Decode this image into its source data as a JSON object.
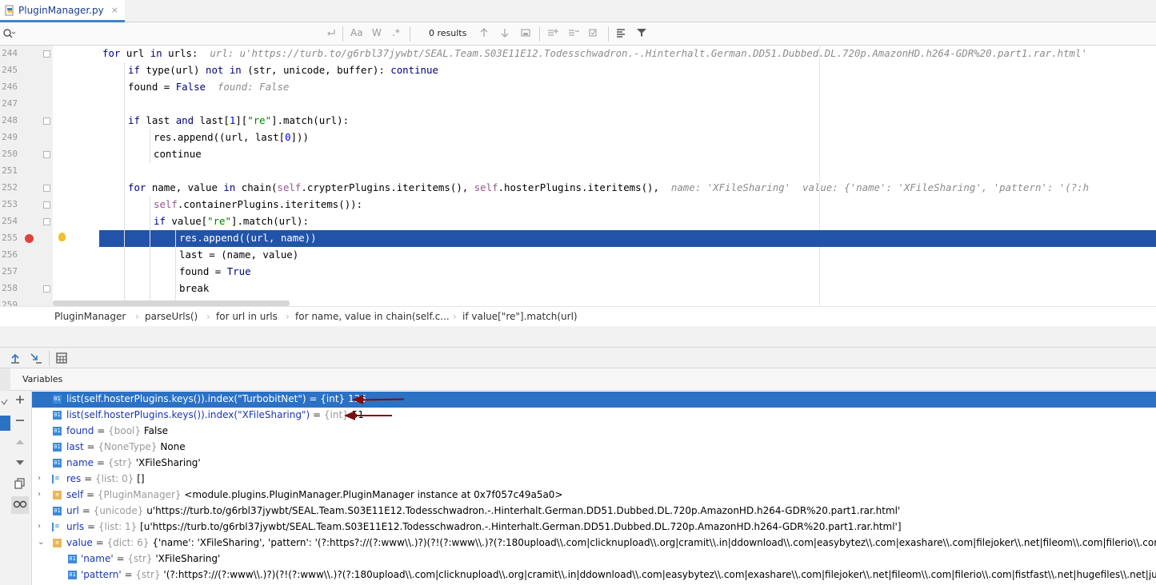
{
  "tab": {
    "filename": "PluginManager.py",
    "close": "×"
  },
  "search": {
    "results": "0 results",
    "match_case": "Aa",
    "words": "W",
    "regex": ".*"
  },
  "editor": {
    "lines": [
      {
        "n": "244"
      },
      {
        "n": "245"
      },
      {
        "n": "246"
      },
      {
        "n": "247"
      },
      {
        "n": "248"
      },
      {
        "n": "249"
      },
      {
        "n": "250"
      },
      {
        "n": "251"
      },
      {
        "n": "252"
      },
      {
        "n": "253"
      },
      {
        "n": "254"
      },
      {
        "n": "255"
      },
      {
        "n": "256"
      },
      {
        "n": "257"
      },
      {
        "n": "258"
      },
      {
        "n": "259"
      }
    ],
    "code": {
      "l244_a": "for",
      "l244_b": " url ",
      "l244_c": "in",
      "l244_d": " urls:  ",
      "l244_hint": "url: u'https://turb.to/g6rbl37jywbt/SEAL.Team.S03E11E12.Todesschwadron.-.Hinterhalt.German.DD51.Dubbed.DL.720p.AmazonHD.h264-GDR%20.part1.rar.html'",
      "l245": "if type(url) not in (str, unicode, buffer): continue",
      "l246_a": "found = ",
      "l246_b": "False",
      "l246_hint": "found: False",
      "l248_a": "if",
      "l248_b": " last ",
      "l248_c": "and",
      "l248_d": " last[",
      "l248_e": "1",
      "l248_f": "][",
      "l248_g": "\"re\"",
      "l248_h": "].match(url):",
      "l249_a": "res.append((url, last[",
      "l249_b": "0",
      "l249_c": "]))",
      "l250": "continue",
      "l252_a": "for",
      "l252_b": " name, value ",
      "l252_c": "in",
      "l252_d": " chain(",
      "l252_e": "self",
      "l252_f": ".crypterPlugins.iteritems(), ",
      "l252_g": "self",
      "l252_h": ".hosterPlugins.iteritems(),  ",
      "l252_hint": "name: 'XFileSharing'  value: {'name': 'XFileSharing', 'pattern': '(?:h",
      "l253_a": "self",
      "l253_b": ".containerPlugins.iteritems()):",
      "l254_a": "if",
      "l254_b": " value[",
      "l254_c": "\"re\"",
      "l254_d": "].match(url):",
      "l255": "res.append((url, name))",
      "l256": "last = (name, value)",
      "l257_a": "found = ",
      "l257_b": "True",
      "l258": "break"
    }
  },
  "breadcrumb": [
    "PluginManager",
    "parseUrls()",
    "for url in urls",
    "for name, value in chain(self.c...",
    "if value[\"re\"].match(url)"
  ],
  "variables_title": "Variables",
  "variables": [
    {
      "icon": "01",
      "name": "list(self.hosterPlugins.keys()).index(\"TurbobitNet\")",
      "type": "{int}",
      "value": "136"
    },
    {
      "icon": "01",
      "name": "list(self.hosterPlugins.keys()).index(\"XFileSharing\")",
      "type": "{int}",
      "value": "51"
    },
    {
      "icon": "01",
      "name": "found",
      "type": "{bool}",
      "value": "False"
    },
    {
      "icon": "01",
      "name": "last",
      "type": "{NoneType}",
      "value": "None"
    },
    {
      "icon": "01",
      "name": "name",
      "type": "{str}",
      "value": "'XFileSharing'"
    },
    {
      "icon": "list",
      "name": "res",
      "type": "{list: 0}",
      "value": "[]"
    },
    {
      "icon": "obj",
      "name": "self",
      "type": "{PluginManager}",
      "value": "<module.plugins.PluginManager.PluginManager instance at 0x7f057c49a5a0>"
    },
    {
      "icon": "01",
      "name": "url",
      "type": "{unicode}",
      "value": "u'https://turb.to/g6rbl37jywbt/SEAL.Team.S03E11E12.Todesschwadron.-.Hinterhalt.German.DD51.Dubbed.DL.720p.AmazonHD.h264-GDR%20.part1.rar.html'"
    },
    {
      "icon": "list",
      "name": "urls",
      "type": "{list: 1}",
      "value": "[u'https://turb.to/g6rbl37jywbt/SEAL.Team.S03E11E12.Todesschwadron.-.Hinterhalt.German.DD51.Dubbed.DL.720p.AmazonHD.h264-GDR%20.part1.rar.html']"
    },
    {
      "icon": "obj",
      "name": "value",
      "type": "{dict: 6}",
      "value": "{'name': 'XFileSharing', 'pattern': '(?:https?://(?:www\\\\.)?)(?!(?:www\\\\.)?(?:180upload\\\\.com|clicknupload\\\\.org|cramit\\\\.in|ddownload\\\\.com|easybytez\\\\.com|exashare\\\\.com|filejoker\\\\.net|fileom\\\\.com|filerio\\\\.com|fistfast"
    },
    {
      "icon": "01",
      "name": "'name'",
      "type": "{str}",
      "value": "'XFileSharing'"
    },
    {
      "icon": "01",
      "name": "'pattern'",
      "type": "{str}",
      "value": "'(?:https?://(?:www\\\\.)?)(?!(?:www\\\\.)?(?:180upload\\\\.com|clicknupload\\\\.org|cramit\\\\.in|ddownload\\\\.com|easybytez\\\\.com|exashare\\\\.com|filejoker\\\\.net|fileom\\\\.com|filerio\\\\.com|fistfast\\\\.net|hugefiles\\\\.net|junocl"
    }
  ],
  "eq": "="
}
